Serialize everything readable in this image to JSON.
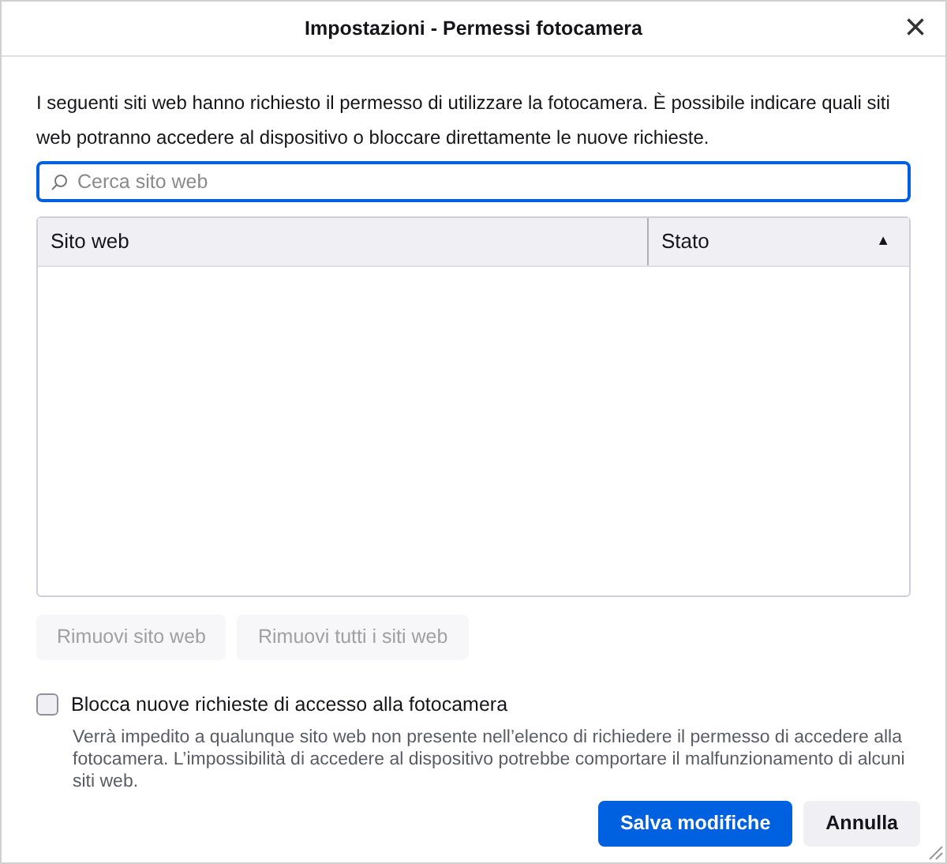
{
  "window": {
    "title": "Impostazioni - Permessi fotocamera",
    "close": "×"
  },
  "description": "I seguenti siti web hanno richiesto il permesso di utilizzare la fotocamera. È possibile indicare quali siti web potranno accedere al dispositivo o bloccare direttamente le nuove richieste.",
  "search": {
    "placeholder": "Cerca sito web",
    "focused": true
  },
  "table": {
    "columns": [
      {
        "label": "Sito web",
        "sorted": false
      },
      {
        "label": "Stato",
        "sorted": true
      }
    ],
    "sort_indicator": "▲"
  },
  "list_buttons": [
    {
      "label": "Rimuovi sito web",
      "disabled": true
    },
    {
      "label": "Rimuovi tutti i siti web",
      "disabled": true
    }
  ],
  "block_option": {
    "label": "Blocca nuove richieste di accesso alla fotocamera",
    "checked": false,
    "help": "Verrà impedito a qualunque sito web non presente nell’elenco di richiedere il permesso di accedere alla fotocamera. L’impossibilità di accedere al dispositivo potrebbe comportare il malfunzionamento di alcuni siti web."
  },
  "footer_buttons": [
    {
      "label": "Salva modifiche",
      "kind": "primary"
    },
    {
      "label": "Annulla",
      "kind": "secondary"
    }
  ]
}
